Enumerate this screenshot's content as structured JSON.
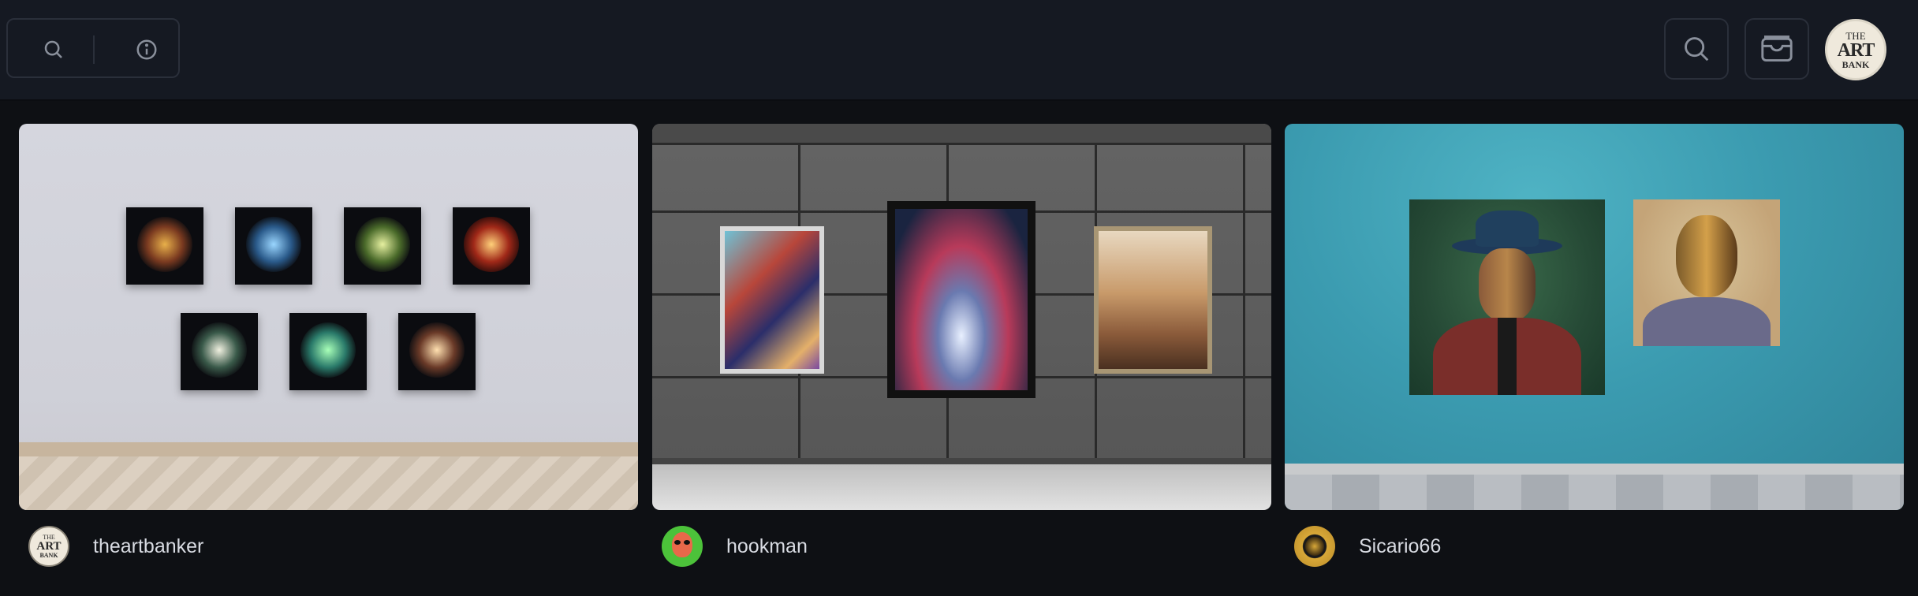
{
  "header": {
    "search_icon": "search-icon",
    "info_icon": "info-icon",
    "right_search_icon": "search-icon",
    "wallet_icon": "wallet-icon",
    "avatar_logo": {
      "line1": "THE",
      "line2": "ART",
      "line3": "BANK"
    }
  },
  "galleries": [
    {
      "owner": "theartbanker",
      "avatar": "the-art-bank-logo",
      "wall": "light-grey"
    },
    {
      "owner": "hookman",
      "avatar": "alien-avatar",
      "wall": "dark-grey-tiles"
    },
    {
      "owner": "Sicario66",
      "avatar": "gold-emblem-avatar",
      "wall": "teal"
    }
  ],
  "colors": {
    "background": "#0e1014",
    "topbar": "#151922",
    "border": "#2a2f3a",
    "text": "#d8dbe2"
  }
}
